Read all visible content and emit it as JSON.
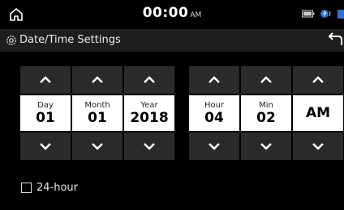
{
  "status": {
    "time": "00:00",
    "ampm": "AM"
  },
  "title": "Date/Time Settings",
  "fields": [
    {
      "label": "Day",
      "value": "01"
    },
    {
      "label": "Month",
      "value": "01"
    },
    {
      "label": "Year",
      "value": "2018"
    },
    {
      "label": "Hour",
      "value": "04"
    },
    {
      "label": "Min",
      "value": "02"
    },
    {
      "label": "",
      "value": "AM"
    }
  ],
  "options": {
    "hour24_label": "24-hour",
    "hour24_checked": false
  },
  "colors": {
    "background": "#000000",
    "button": "#2b2b2b",
    "value_box": "#ffffff",
    "titlebar": "#1e1e1e"
  },
  "icons": {
    "home": "home-icon",
    "settings": "gear-icon",
    "back": "back-icon",
    "up": "chevron-up-icon",
    "down": "chevron-down-icon"
  }
}
